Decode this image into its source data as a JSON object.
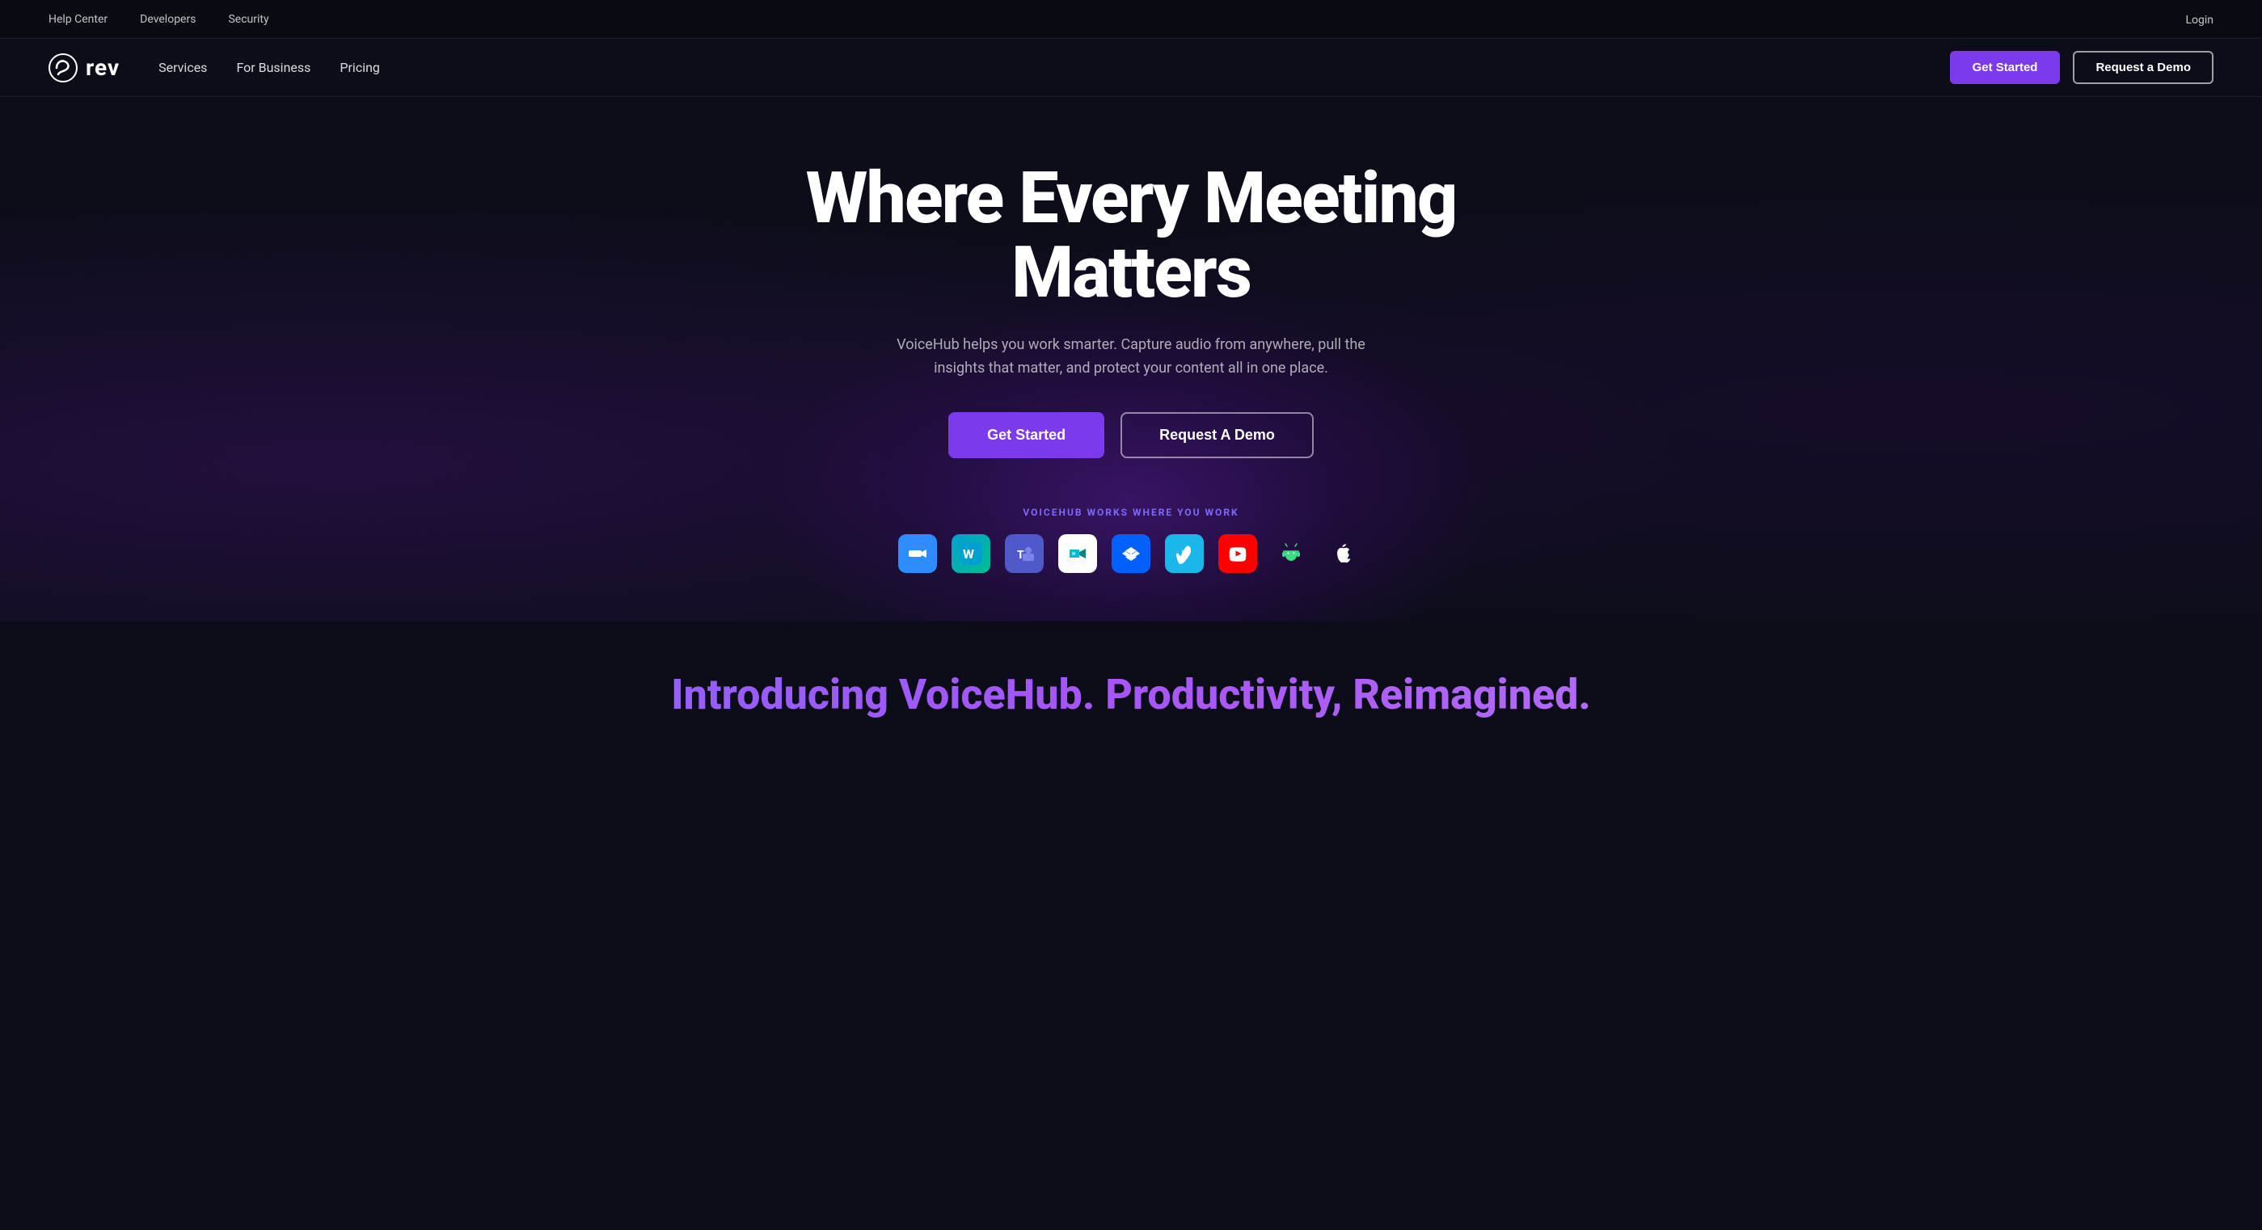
{
  "topbar": {
    "links": [
      {
        "label": "Help Center",
        "key": "help-center"
      },
      {
        "label": "Developers",
        "key": "developers"
      },
      {
        "label": "Security",
        "key": "security"
      }
    ],
    "login_label": "Login"
  },
  "nav": {
    "logo_text": "rev",
    "links": [
      {
        "label": "Services",
        "key": "services"
      },
      {
        "label": "For Business",
        "key": "for-business"
      },
      {
        "label": "Pricing",
        "key": "pricing"
      }
    ],
    "get_started_label": "Get Started",
    "request_demo_label": "Request a Demo"
  },
  "hero": {
    "title": "Where Every Meeting Matters",
    "subtitle": "VoiceHub helps you work smarter. Capture audio from anywhere, pull the insights that matter, and protect your content all in one place.",
    "get_started_label": "Get Started",
    "request_demo_label": "Request A Demo",
    "integrations_label": "VOICEHUB WORKS WHERE YOU WORK",
    "integrations": [
      {
        "name": "Zoom",
        "key": "zoom",
        "symbol": "🎥"
      },
      {
        "name": "Webex",
        "key": "webex",
        "symbol": "🔵"
      },
      {
        "name": "Microsoft Teams",
        "key": "teams",
        "symbol": "👥"
      },
      {
        "name": "Google Meet",
        "key": "meet",
        "symbol": "📹"
      },
      {
        "name": "Dropbox",
        "key": "dropbox",
        "symbol": "📦"
      },
      {
        "name": "Vimeo",
        "key": "vimeo",
        "symbol": "▶"
      },
      {
        "name": "YouTube",
        "key": "youtube",
        "symbol": "▶"
      },
      {
        "name": "Android",
        "key": "android",
        "symbol": "🤖"
      },
      {
        "name": "Apple",
        "key": "apple",
        "symbol": "🍎"
      }
    ]
  },
  "bottom": {
    "title": "Introducing VoiceHub. Productivity, Reimagined."
  }
}
